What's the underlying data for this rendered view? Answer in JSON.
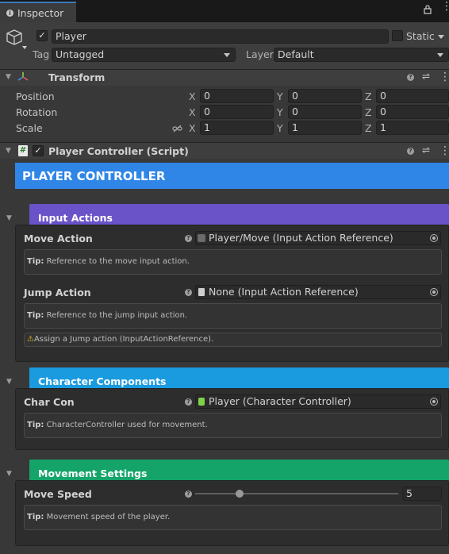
{
  "tab": {
    "title": "Inspector"
  },
  "gameobject": {
    "name": "Player",
    "static_label": "Static",
    "tag_label": "Tag",
    "tag_value": "Untagged",
    "layer_label": "Layer",
    "layer_value": "Default"
  },
  "transform": {
    "title": "Transform",
    "rows": [
      {
        "label": "Position",
        "x": "0",
        "y": "0",
        "z": "0"
      },
      {
        "label": "Rotation",
        "x": "0",
        "y": "0",
        "z": "0"
      },
      {
        "label": "Scale",
        "x": "1",
        "y": "1",
        "z": "1"
      }
    ],
    "axis": {
      "x": "X",
      "y": "Y",
      "z": "Z"
    }
  },
  "script": {
    "title": "Player Controller (Script)",
    "banner": "PLAYER CONTROLLER",
    "banner_color": "#2f86e6",
    "sections": [
      {
        "title": "Input Actions",
        "color": "#6a52c9",
        "fields": [
          {
            "label": "Move Action",
            "value": "Player/Move (Input Action Reference)",
            "tip_prefix": "Tip:",
            "tip": "Reference to the move input action."
          },
          {
            "label": "Jump Action",
            "value": "None (Input Action Reference)",
            "tip_prefix": "Tip:",
            "tip": "Reference to the jump input action.",
            "warning": "Assign a Jump action (InputActionReference)."
          }
        ]
      },
      {
        "title": "Character Components",
        "color": "#1a9be0",
        "fields": [
          {
            "label": "Char Con",
            "value": "Player (Character Controller)",
            "tip_prefix": "Tip:",
            "tip": "CharacterController used for movement."
          }
        ]
      },
      {
        "title": "Movement Settings",
        "color": "#14a46a",
        "fields": [
          {
            "label": "Move Speed",
            "value": "5",
            "slider_fraction": 0.22,
            "tip_prefix": "Tip:",
            "tip": "Movement speed of the player."
          }
        ]
      }
    ]
  }
}
